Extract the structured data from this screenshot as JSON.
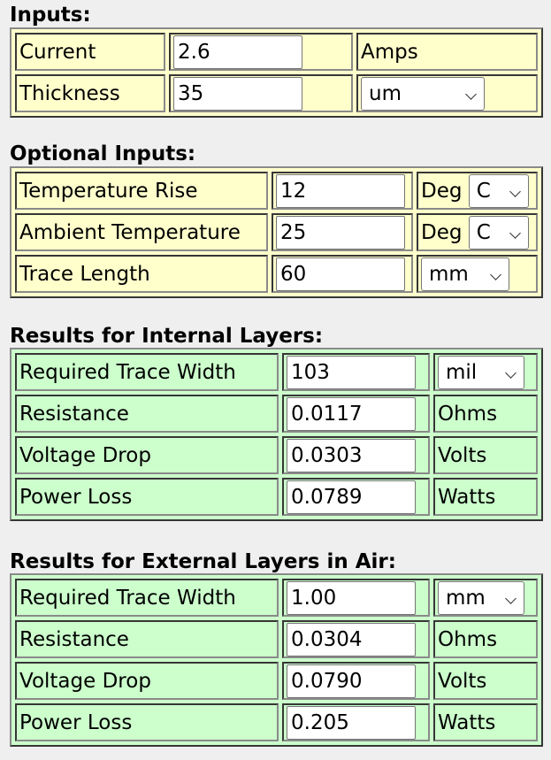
{
  "inputs": {
    "heading": "Inputs:",
    "rows": [
      {
        "label": "Current",
        "value": "2.6",
        "unit": "Amps"
      },
      {
        "label": "Thickness",
        "value": "35",
        "unit": "um"
      }
    ]
  },
  "optional": {
    "heading": "Optional Inputs:",
    "rows": [
      {
        "label": "Temperature Rise",
        "value": "12",
        "unit_prefix": "Deg",
        "unit": "C"
      },
      {
        "label": "Ambient Temperature",
        "value": "25",
        "unit_prefix": "Deg",
        "unit": "C"
      },
      {
        "label": "Trace Length",
        "value": "60",
        "unit": "mm"
      }
    ]
  },
  "internal": {
    "heading": "Results for Internal Layers:",
    "rows": [
      {
        "label": "Required Trace Width",
        "value": "103",
        "unit": "mil"
      },
      {
        "label": "Resistance",
        "value": "0.0117",
        "unit": "Ohms"
      },
      {
        "label": "Voltage Drop",
        "value": "0.0303",
        "unit": "Volts"
      },
      {
        "label": "Power Loss",
        "value": "0.0789",
        "unit": "Watts"
      }
    ]
  },
  "external": {
    "heading": "Results for External Layers in Air:",
    "rows": [
      {
        "label": "Required Trace Width",
        "value": "1.00",
        "unit": "mm"
      },
      {
        "label": "Resistance",
        "value": "0.0304",
        "unit": "Ohms"
      },
      {
        "label": "Voltage Drop",
        "value": "0.0790",
        "unit": "Volts"
      },
      {
        "label": "Power Loss",
        "value": "0.205",
        "unit": "Watts"
      }
    ]
  },
  "colors": {
    "input_bg": "#ffffcc",
    "result_bg": "#ccffcc",
    "page_bg": "#efefef"
  }
}
